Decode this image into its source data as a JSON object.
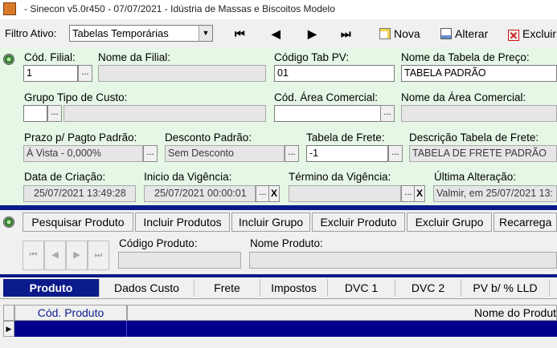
{
  "window": {
    "title": "- Sinecon v5.0r450 - 07/07/2021 - Idústria de Massas e Biscoitos Modelo"
  },
  "toolbar": {
    "filter_label": "Filtro Ativo:",
    "filter_value": "Tabelas Temporárias",
    "nav_first": "⏮",
    "nav_prev": "◀",
    "nav_next": "▶",
    "nav_last": "⏭",
    "new_label": "Nova",
    "edit_label": "Alterar",
    "delete_label": "Excluir"
  },
  "form": {
    "cod_filial_label": "Cód. Filial:",
    "cod_filial_value": "1",
    "nome_filial_label": "Nome da Filial:",
    "nome_filial_value": "",
    "codigo_tab_pv_label": "Código Tab PV:",
    "codigo_tab_pv_value": "01",
    "nome_tabela_label": "Nome da Tabela de Preço:",
    "nome_tabela_value": "TABELA PADRÃO",
    "grupo_tipo_custo_label": "Grupo Tipo de Custo:",
    "grupo_tipo_custo_value": "",
    "cod_area_label": "Cód. Área Comercial:",
    "cod_area_value": "",
    "nome_area_label": "Nome da Área Comercial:",
    "nome_area_value": "",
    "prazo_label": "Prazo p/ Pagto Padrão:",
    "prazo_value": "À Vista - 0,000%",
    "desconto_label": "Desconto Padrão:",
    "desconto_value": "Sem Desconto",
    "tabela_frete_label": "Tabela de Frete:",
    "tabela_frete_value": "-1",
    "desc_frete_label": "Descrição Tabela de Frete:",
    "desc_frete_value": "TABELA DE FRETE PADRÃO",
    "data_criacao_label": "Data de Criação:",
    "data_criacao_value": "25/07/2021 13:49:28",
    "inicio_vigencia_label": "Inicio da Vigência:",
    "inicio_vigencia_value": "25/07/2021 00:00:01",
    "termino_vigencia_label": "Término da Vigência:",
    "termino_vigencia_value": "",
    "ultima_alteracao_label": "Última Alteração:",
    "ultima_alteracao_value": "Valmir, em 25/07/2021 13:",
    "dots": "...",
    "clear": "X"
  },
  "actions": {
    "pesquisar": "Pesquisar Produto",
    "incluir_produtos": "Incluir Produtos",
    "incluir_grupo": "Incluir Grupo",
    "excluir_produto": "Excluir Produto",
    "excluir_grupo": "Excluir Grupo",
    "recarregar": "Recarrega"
  },
  "product_nav": {
    "first": "⏮",
    "prev": "◀",
    "next": "▶",
    "last": "⏭",
    "codigo_label": "Código Produto:",
    "nome_label": "Nome Produto:"
  },
  "tabs": [
    "Produto",
    "Dados Custo",
    "Frete",
    "Impostos",
    "DVC 1",
    "DVC 2",
    "PV b/ % LLD"
  ],
  "grid": {
    "col_codigo": "Cód. Produto",
    "col_nome": "Nome do Produt",
    "row_indicator": "▶"
  },
  "colors": {
    "accent": "#0b1a8a",
    "panel": "#e6f7e6"
  }
}
